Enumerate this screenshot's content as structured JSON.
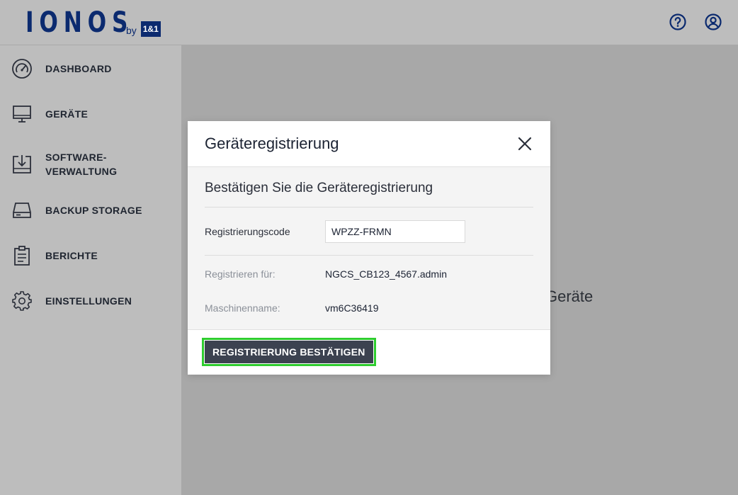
{
  "brand": {
    "wordmark": "IONOS",
    "by": "by",
    "badge": "1&1",
    "color": "#0b2a6f"
  },
  "header_icons": [
    "help-icon",
    "account-icon"
  ],
  "sidebar": {
    "items": [
      {
        "label": "DASHBOARD",
        "icon": "dashboard-gauge-icon"
      },
      {
        "label": "GERÄTE",
        "icon": "monitor-icon"
      },
      {
        "label": "SOFTWARE-\nVERWALTUNG",
        "icon": "software-download-icon"
      },
      {
        "label": "BACKUP STORAGE",
        "icon": "storage-drive-icon"
      },
      {
        "label": "BERICHTE",
        "icon": "clipboard-report-icon"
      },
      {
        "label": "EINSTELLUNGEN",
        "icon": "gear-icon"
      }
    ]
  },
  "background": {
    "partial_text": "Geräte"
  },
  "modal": {
    "title": "Geräteregistrierung",
    "subtitle": "Bestätigen Sie die Geräteregistrierung",
    "code_label": "Registrierungscode",
    "code_value": "WPZZ-FRMN",
    "register_for_label": "Registrieren für:",
    "register_for_value": "NGCS_CB123_4567.admin",
    "machine_label": "Maschinenname:",
    "machine_value": "vm6C36419",
    "confirm_button": "REGISTRIERUNG BESTÄTIGEN"
  },
  "colors": {
    "highlight": "#2ecc2e",
    "button": "#3c4250"
  }
}
